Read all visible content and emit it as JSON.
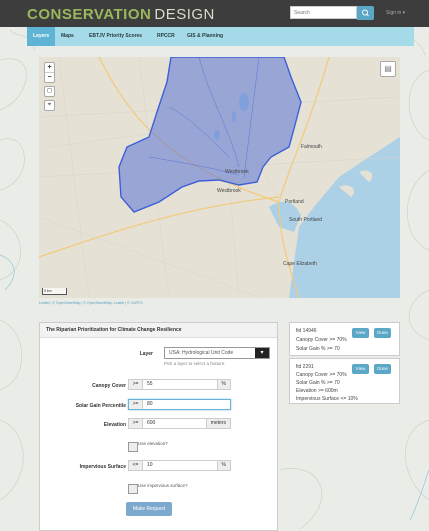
{
  "brand": {
    "part1": "CONSERVATION",
    "part2": "DESIGN"
  },
  "search": {
    "placeholder": "Search"
  },
  "signin": "Sign in ▾",
  "nav": [
    "Layers",
    "Maps",
    "EBTJV Priority Scores",
    "RPCCR",
    "GIS & Planning"
  ],
  "map": {
    "zoom_in": "+",
    "zoom_out": "−",
    "labels": [
      "Westbrook",
      "Westbrook",
      "Portland",
      "South Portland",
      "Cape Elizabeth",
      "Falmouth"
    ],
    "scale": "5 km",
    "attribution": "Leaflet | © OpenStreetMap | © OpenStreetMap, Leaflet | © CARTO"
  },
  "form": {
    "title": "The Riparian Prioritization for Climate Change Resilience",
    "layer_label": "Layer",
    "layer_value": "USA: Hydrological Unit Code",
    "layer_help": "Pick a layer to select a feature.",
    "canopy_label": "Canopy Cover",
    "canopy_op": ">=",
    "canopy_value": "55",
    "canopy_unit": "%",
    "solar_label": "Solar Gain Percentile",
    "solar_op": ">=",
    "solar_value": "80",
    "elev_label": "Elevation",
    "elev_op": ">=",
    "elev_value": "600",
    "elev_unit": "meters",
    "use_elev": "Use elevation?",
    "imperv_label": "Impervious Surface",
    "imperv_op": "<=",
    "imperv_value": "10",
    "imperv_unit": "%",
    "use_imperv": "Use impervious surface?",
    "submit": "Make Request"
  },
  "cards": [
    {
      "id": "fid 14946",
      "lines": [
        "Canopy Cover >= 70%",
        "Solar Gain % >= 70"
      ],
      "view": "View",
      "done": "Done"
    },
    {
      "id": "fid 2291",
      "lines": [
        "Canopy Cover >= 70%",
        "Solar Gain % >= 70",
        "Elevation >= 600m",
        "Impervious Surface <= 10%"
      ],
      "view": "View",
      "done": "Done"
    }
  ],
  "colors": {
    "header": "#3d3d3d",
    "nav": "#a5dbe8",
    "active_tab": "#5fb4d5",
    "polygon": "#5b77d6",
    "button": "#5aa7c6"
  }
}
